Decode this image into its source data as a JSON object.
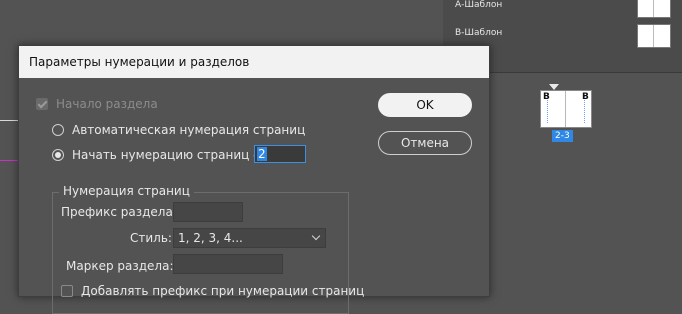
{
  "background": {
    "masters": [
      {
        "label": "А-Шаблон"
      },
      {
        "label": "В-Шаблон"
      }
    ],
    "spread": {
      "left_letter": "В",
      "right_letter": "В",
      "label": "2-3"
    }
  },
  "dialog": {
    "title": "Параметры нумерации и разделов",
    "section_start_label": "Начало раздела",
    "auto_numbering_label": "Автоматическая нумерация страниц",
    "start_at_label": "Начать нумерацию страниц с:",
    "start_at_value": "2",
    "ok_label": "OK",
    "cancel_label": "Отмена",
    "page_numbering": {
      "title": "Нумерация страниц",
      "prefix_label": "Префикс раздела:",
      "prefix_value": "",
      "style_label": "Стиль:",
      "style_value": "1, 2, 3, 4...",
      "marker_label": "Маркер раздела:",
      "marker_value": "",
      "include_prefix_label": "Добавлять префикс при нумерации страниц"
    }
  },
  "colors": {
    "accent": "#2f87e6",
    "dialog_bg": "#535353",
    "titlebar": "#f2f2f2"
  }
}
